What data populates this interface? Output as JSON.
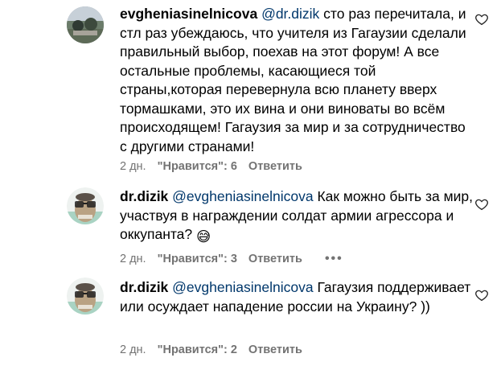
{
  "comments": [
    {
      "username": "evgheniasinelnicova",
      "mention": "@dr.dizik",
      "text": "сто раз перечитала, и стл раз убеждаюсь, что учителя из Гагаузии сделали правильный выбор, поехав на этот форум! А все остальные проблемы, касающиеся той страны,которая перевернула всю планету вверх тормашками, это их вина и они виноваты во всём происходящем! Гагаузия за мир и за сотрудничество с другими странами!",
      "time": "2 дн.",
      "likes": "\"Нравится\": 6",
      "reply": "Ответить"
    },
    {
      "username": "dr.dizik",
      "mention": "@evgheniasinelnicova",
      "text": "Как можно быть за мир, участвуя в награждении солдат армии агрессора и оккупанта?",
      "emoji": "😅",
      "time": "2 дн.",
      "likes": "\"Нравится\": 3",
      "reply": "Ответить",
      "more": "•••"
    },
    {
      "username": "dr.dizik",
      "mention": "@evgheniasinelnicova",
      "text": "Гагаузия поддерживает или осуждает нападение россии на Украину? ))",
      "time": "2 дн.",
      "likes": "\"Нравится\": 2",
      "reply": "Ответить"
    }
  ],
  "icons": {
    "like": "heart-outline-icon",
    "more": "more-options-icon"
  },
  "colors": {
    "mention": "#00376b",
    "meta": "#737373"
  }
}
